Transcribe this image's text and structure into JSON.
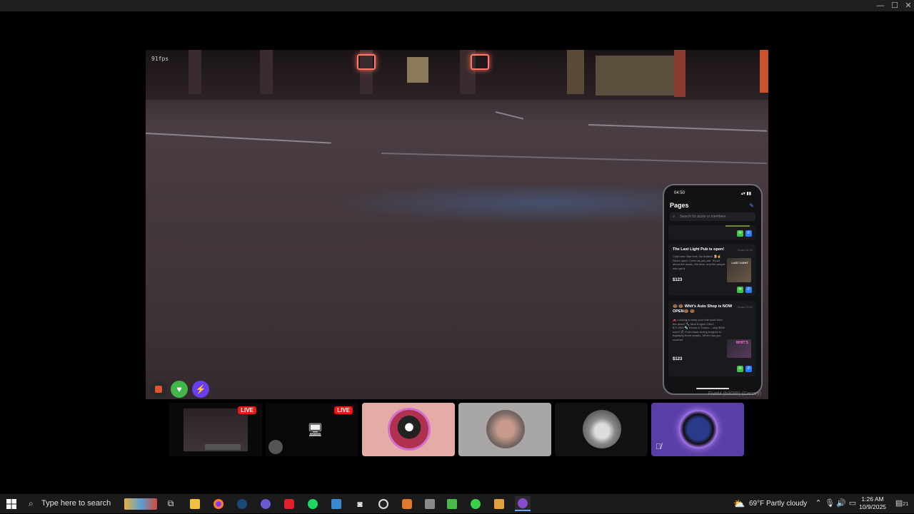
{
  "window": {
    "minimize_glyph": "—",
    "maximize_glyph": "☐",
    "close_glyph": "✕"
  },
  "stream": {
    "fps_label": "91fps",
    "watermark": "FiveM (b3095) (Canary)"
  },
  "hud": {
    "icons": [
      "burger-icon",
      "heart-icon",
      "lightning-icon"
    ],
    "colors": [
      "#e0532d",
      "#43b64a",
      "#6a3df0"
    ]
  },
  "phone": {
    "time": "04:50",
    "status_right": "▴▾ ▮▮",
    "title": "Pages",
    "search_placeholder": "Search for posts or members",
    "cards": [
      {
        "title": "The Last Light Pub is open!",
        "date": "Today 04:45",
        "body": "Cold beer. Bad luck. No bullshit. 🍺✌ Doors open. Come as you are. It's all about the music, the beer, and the people who get it.",
        "price": "$123",
        "image_text": "LAST LIGHT"
      },
      {
        "title": "🍩 🍩 Whit's Auto Shop is NOW OPEN🍩 🍩",
        "date": "Today 03:52",
        "body": "🚗 Looking to keep your ride back from the dead? 🔧 Mod Engine ONLY $71,000! 🔩 Hoods & Trunks – only $500 each! 🛠 From basic tuning engines to frightfully fresh repairs, Whit's has you covered.",
        "price": "$123",
        "image_text": "WHIT'S"
      }
    ]
  },
  "thumbnails": [
    {
      "live": "LIVE",
      "kind": "game"
    },
    {
      "live": "LIVE",
      "kind": "screen"
    },
    {
      "live": "",
      "kind": "avatar-anime",
      "bg": "#e5aba6"
    },
    {
      "live": "",
      "kind": "avatar-tattoo",
      "bg": "#a9a6a6"
    },
    {
      "live": "",
      "kind": "avatar-sketch",
      "bg": "#111111"
    },
    {
      "live": "",
      "kind": "avatar-wolf",
      "bg": "#5a3ea8",
      "muted_icon": "mic-off-icon"
    }
  ],
  "taskbar": {
    "search_placeholder": "Type here to search",
    "weather": "69°F  Partly cloudy",
    "time": "1:26 AM",
    "date": "10/9/2025",
    "notification_count": "21"
  }
}
